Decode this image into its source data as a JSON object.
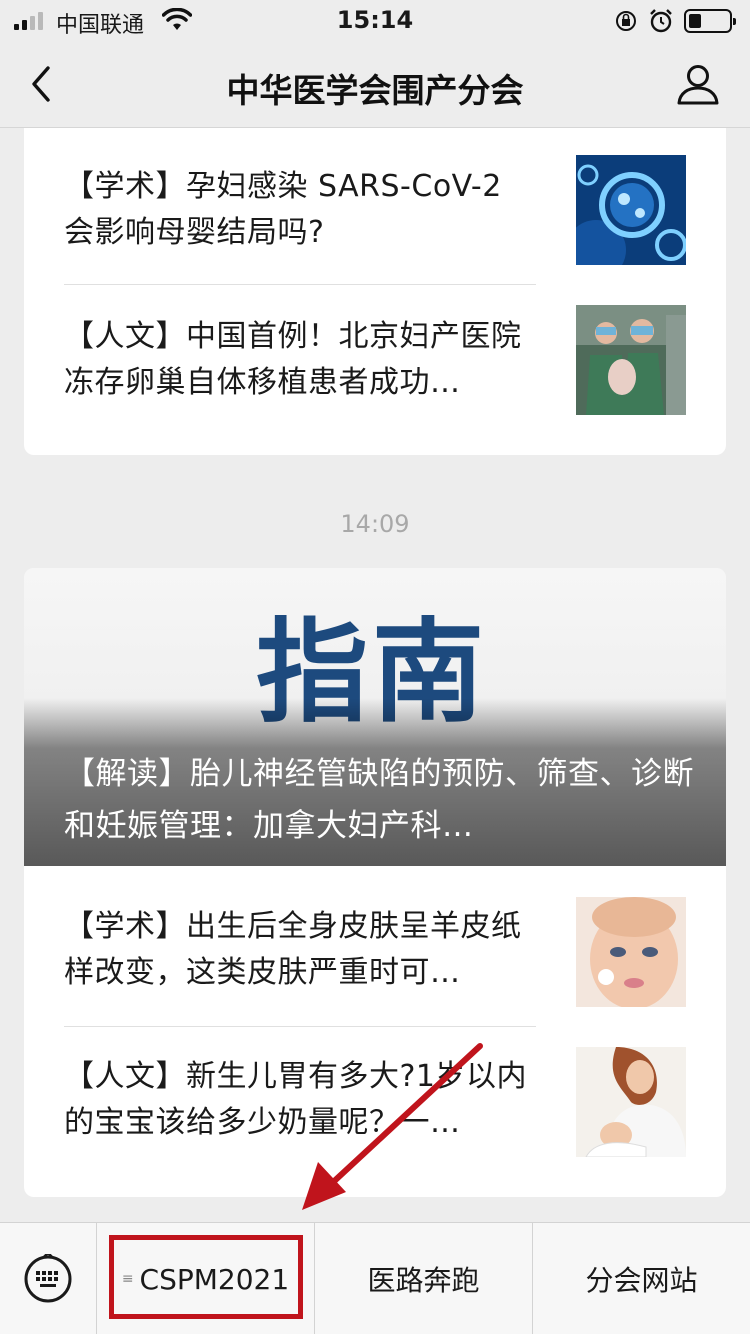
{
  "status_bar": {
    "carrier": "中国联通",
    "time": "15:14"
  },
  "nav": {
    "title": "中华医学会围产分会"
  },
  "articles_top": [
    {
      "title": "【学术】孕妇感染 SARS-CoV-2 会影响母婴结局吗?",
      "thumb": "virus-thumbnail"
    },
    {
      "title": "【人文】中国首例！北京妇产医院冻存卵巢自体移植患者成功…",
      "thumb": "doctors-baby-thumbnail"
    }
  ],
  "time_divider": "14:09",
  "hero": {
    "image_text": "指南",
    "title": "【解读】胎儿神经管缺陷的预防、筛查、诊断和妊娠管理：加拿大妇产科…"
  },
  "articles_bottom": [
    {
      "title": "【学术】出生后全身皮肤呈羊皮纸样改变，这类皮肤严重时可…",
      "thumb": "baby-skin-thumbnail"
    },
    {
      "title": "【人文】新生儿胃有多大?1岁以内的宝宝该给多少奶量呢？一…",
      "thumb": "mother-feeding-thumbnail"
    }
  ],
  "menu": {
    "tabs": [
      "CSPM2021",
      "医路奔跑",
      "分会网站"
    ],
    "submenu_marker": "≡"
  },
  "annotation": {
    "color": "#c0141c"
  }
}
